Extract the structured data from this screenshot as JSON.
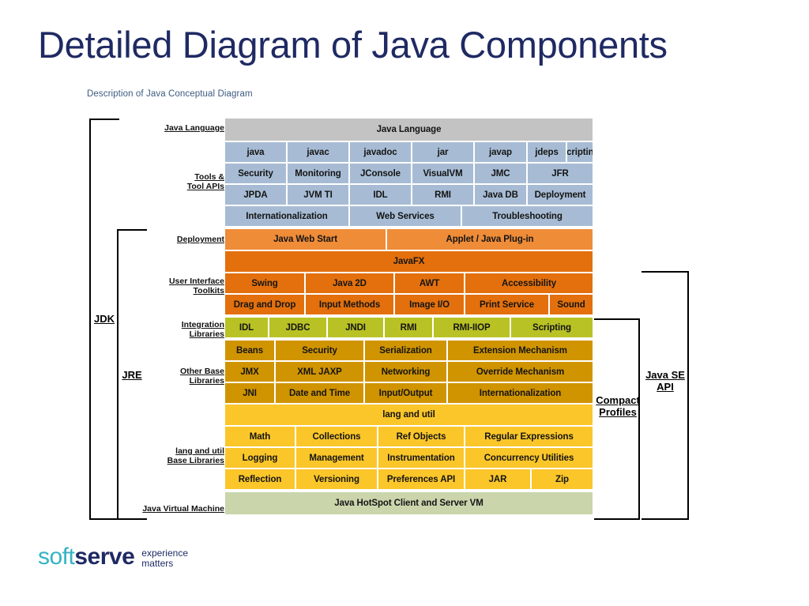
{
  "slide": {
    "title": "Detailed Diagram of Java Components",
    "subtitle": "Description of Java Conceptual Diagram"
  },
  "logo": {
    "soft": "soft",
    "serve": "serve",
    "tagline_line1": "experience",
    "tagline_line2": "matters",
    "soft_color": "#35b3c4",
    "serve_color": "#1f2a63"
  },
  "brackets": {
    "jdk": "JDK",
    "jre": "JRE",
    "compact_profiles_line1": "Compact",
    "compact_profiles_line2": "Profiles",
    "java_se_api_line1": "Java SE",
    "java_se_api_line2": "API"
  },
  "row_labels": {
    "java_language": [
      "Java Language"
    ],
    "tools_and_tool_apis": [
      "Tools &",
      "Tool APIs"
    ],
    "deployment": [
      "Deployment"
    ],
    "user_interface_toolkits": [
      "User Interface",
      "Toolkits"
    ],
    "integration_libraries": [
      "Integration",
      "Libraries"
    ],
    "other_base_libraries": [
      "Other Base",
      "Libraries"
    ],
    "lang_and_util_base_libraries": [
      "lang and util",
      "Base Libraries"
    ],
    "java_virtual_machine": [
      "Java Virtual Machine"
    ]
  },
  "colors": {
    "java_language_header": "#c3c3c3",
    "tools": "#a7bcd4",
    "deployment": "#ef8c38",
    "ui_toolkits": "#e3700d",
    "integration": "#b9c224",
    "other_base": "#d09400",
    "lang_util": "#fbc629",
    "jvm": "#cad5ac",
    "title": "#1f2a63",
    "subtitle": "#3d5a80"
  },
  "stack": {
    "java_language_header": "Java Language",
    "tools_row1": [
      "java",
      "javac",
      "javadoc",
      "jar",
      "javap",
      "jdeps",
      "Scripting"
    ],
    "tools_row2": [
      "Security",
      "Monitoring",
      "JConsole",
      "VisualVM",
      "JMC",
      "JFR"
    ],
    "tools_row3": [
      "JPDA",
      "JVM TI",
      "IDL",
      "RMI",
      "Java DB",
      "Deployment"
    ],
    "tools_row4": [
      "Internationalization",
      "Web Services",
      "Troubleshooting"
    ],
    "deployment_row": [
      "Java Web Start",
      "Applet / Java Plug-in"
    ],
    "javafx_row": [
      "JavaFX"
    ],
    "ui_row1": [
      "Swing",
      "Java 2D",
      "AWT",
      "Accessibility"
    ],
    "ui_row2": [
      "Drag and Drop",
      "Input Methods",
      "Image I/O",
      "Print Service",
      "Sound"
    ],
    "integration_row": [
      "IDL",
      "JDBC",
      "JNDI",
      "RMI",
      "RMI-IIOP",
      "Scripting"
    ],
    "other_base_row1": [
      "Beans",
      "Security",
      "Serialization",
      "Extension Mechanism"
    ],
    "other_base_row2": [
      "JMX",
      "XML JAXP",
      "Networking",
      "Override Mechanism"
    ],
    "other_base_row3": [
      "JNI",
      "Date and Time",
      "Input/Output",
      "Internationalization"
    ],
    "lang_util_header": "lang and util",
    "lang_util_row1": [
      "Math",
      "Collections",
      "Ref Objects",
      "Regular Expressions"
    ],
    "lang_util_row2": [
      "Logging",
      "Management",
      "Instrumentation",
      "Concurrency Utilities"
    ],
    "lang_util_row3": [
      "Reflection",
      "Versioning",
      "Preferences API",
      "JAR",
      "Zip"
    ],
    "jvm_row": "Java HotSpot Client and Server VM"
  }
}
